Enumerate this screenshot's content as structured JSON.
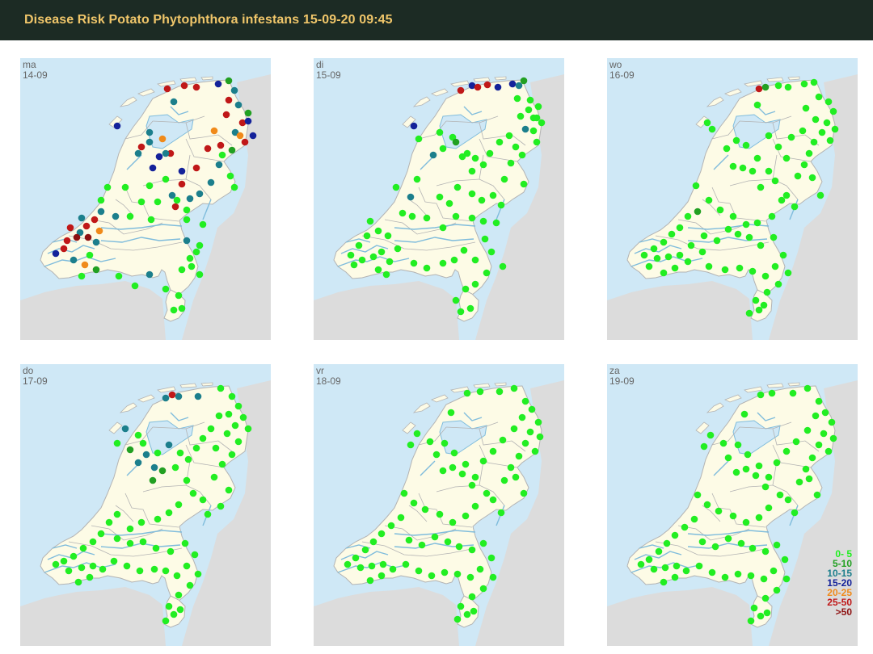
{
  "header": {
    "title": "Disease Risk Potato Phytophthora infestans 15-09-20 09:45"
  },
  "colors": {
    "sea": "#cfe8f6",
    "land": "#fdfbe6",
    "foreign": "#dcdcdc",
    "border": "#b3b3b3",
    "water": "#7fbcdc",
    "header_bg": "#1c2b24",
    "title": "#f0c66a"
  },
  "legend": [
    {
      "label": "0- 5",
      "color": "#22ee22"
    },
    {
      "label": "5-10",
      "color": "#22a022"
    },
    {
      "label": "10-15",
      "color": "#1c7f8c"
    },
    {
      "label": "15-20",
      "color": "#14229a"
    },
    {
      "label": "20-25",
      "color": "#f08a1a"
    },
    {
      "label": "25-50",
      "color": "#c01818"
    },
    {
      "label": ">50",
      "color": "#8e1010"
    }
  ],
  "panels": [
    {
      "day": "ma",
      "date": "14-09"
    },
    {
      "day": "di",
      "date": "15-09"
    },
    {
      "day": "wo",
      "date": "16-09"
    },
    {
      "day": "do",
      "date": "17-09"
    },
    {
      "day": "vr",
      "date": "18-09"
    },
    {
      "day": "za",
      "date": "19-09"
    }
  ]
}
